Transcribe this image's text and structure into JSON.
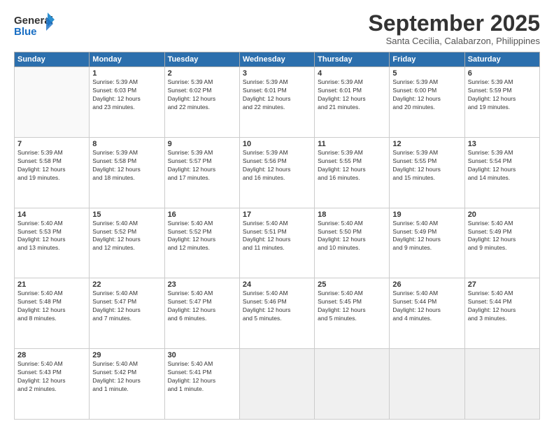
{
  "header": {
    "logo_general": "General",
    "logo_blue": "Blue",
    "month_title": "September 2025",
    "subtitle": "Santa Cecilia, Calabarzon, Philippines"
  },
  "weekdays": [
    "Sunday",
    "Monday",
    "Tuesday",
    "Wednesday",
    "Thursday",
    "Friday",
    "Saturday"
  ],
  "weeks": [
    [
      {
        "day": "",
        "info": ""
      },
      {
        "day": "1",
        "info": "Sunrise: 5:39 AM\nSunset: 6:03 PM\nDaylight: 12 hours\nand 23 minutes."
      },
      {
        "day": "2",
        "info": "Sunrise: 5:39 AM\nSunset: 6:02 PM\nDaylight: 12 hours\nand 22 minutes."
      },
      {
        "day": "3",
        "info": "Sunrise: 5:39 AM\nSunset: 6:01 PM\nDaylight: 12 hours\nand 22 minutes."
      },
      {
        "day": "4",
        "info": "Sunrise: 5:39 AM\nSunset: 6:01 PM\nDaylight: 12 hours\nand 21 minutes."
      },
      {
        "day": "5",
        "info": "Sunrise: 5:39 AM\nSunset: 6:00 PM\nDaylight: 12 hours\nand 20 minutes."
      },
      {
        "day": "6",
        "info": "Sunrise: 5:39 AM\nSunset: 5:59 PM\nDaylight: 12 hours\nand 19 minutes."
      }
    ],
    [
      {
        "day": "7",
        "info": "Sunrise: 5:39 AM\nSunset: 5:58 PM\nDaylight: 12 hours\nand 19 minutes."
      },
      {
        "day": "8",
        "info": "Sunrise: 5:39 AM\nSunset: 5:58 PM\nDaylight: 12 hours\nand 18 minutes."
      },
      {
        "day": "9",
        "info": "Sunrise: 5:39 AM\nSunset: 5:57 PM\nDaylight: 12 hours\nand 17 minutes."
      },
      {
        "day": "10",
        "info": "Sunrise: 5:39 AM\nSunset: 5:56 PM\nDaylight: 12 hours\nand 16 minutes."
      },
      {
        "day": "11",
        "info": "Sunrise: 5:39 AM\nSunset: 5:55 PM\nDaylight: 12 hours\nand 16 minutes."
      },
      {
        "day": "12",
        "info": "Sunrise: 5:39 AM\nSunset: 5:55 PM\nDaylight: 12 hours\nand 15 minutes."
      },
      {
        "day": "13",
        "info": "Sunrise: 5:39 AM\nSunset: 5:54 PM\nDaylight: 12 hours\nand 14 minutes."
      }
    ],
    [
      {
        "day": "14",
        "info": "Sunrise: 5:40 AM\nSunset: 5:53 PM\nDaylight: 12 hours\nand 13 minutes."
      },
      {
        "day": "15",
        "info": "Sunrise: 5:40 AM\nSunset: 5:52 PM\nDaylight: 12 hours\nand 12 minutes."
      },
      {
        "day": "16",
        "info": "Sunrise: 5:40 AM\nSunset: 5:52 PM\nDaylight: 12 hours\nand 12 minutes."
      },
      {
        "day": "17",
        "info": "Sunrise: 5:40 AM\nSunset: 5:51 PM\nDaylight: 12 hours\nand 11 minutes."
      },
      {
        "day": "18",
        "info": "Sunrise: 5:40 AM\nSunset: 5:50 PM\nDaylight: 12 hours\nand 10 minutes."
      },
      {
        "day": "19",
        "info": "Sunrise: 5:40 AM\nSunset: 5:49 PM\nDaylight: 12 hours\nand 9 minutes."
      },
      {
        "day": "20",
        "info": "Sunrise: 5:40 AM\nSunset: 5:49 PM\nDaylight: 12 hours\nand 9 minutes."
      }
    ],
    [
      {
        "day": "21",
        "info": "Sunrise: 5:40 AM\nSunset: 5:48 PM\nDaylight: 12 hours\nand 8 minutes."
      },
      {
        "day": "22",
        "info": "Sunrise: 5:40 AM\nSunset: 5:47 PM\nDaylight: 12 hours\nand 7 minutes."
      },
      {
        "day": "23",
        "info": "Sunrise: 5:40 AM\nSunset: 5:47 PM\nDaylight: 12 hours\nand 6 minutes."
      },
      {
        "day": "24",
        "info": "Sunrise: 5:40 AM\nSunset: 5:46 PM\nDaylight: 12 hours\nand 5 minutes."
      },
      {
        "day": "25",
        "info": "Sunrise: 5:40 AM\nSunset: 5:45 PM\nDaylight: 12 hours\nand 5 minutes."
      },
      {
        "day": "26",
        "info": "Sunrise: 5:40 AM\nSunset: 5:44 PM\nDaylight: 12 hours\nand 4 minutes."
      },
      {
        "day": "27",
        "info": "Sunrise: 5:40 AM\nSunset: 5:44 PM\nDaylight: 12 hours\nand 3 minutes."
      }
    ],
    [
      {
        "day": "28",
        "info": "Sunrise: 5:40 AM\nSunset: 5:43 PM\nDaylight: 12 hours\nand 2 minutes."
      },
      {
        "day": "29",
        "info": "Sunrise: 5:40 AM\nSunset: 5:42 PM\nDaylight: 12 hours\nand 1 minute."
      },
      {
        "day": "30",
        "info": "Sunrise: 5:40 AM\nSunset: 5:41 PM\nDaylight: 12 hours\nand 1 minute."
      },
      {
        "day": "",
        "info": ""
      },
      {
        "day": "",
        "info": ""
      },
      {
        "day": "",
        "info": ""
      },
      {
        "day": "",
        "info": ""
      }
    ]
  ]
}
